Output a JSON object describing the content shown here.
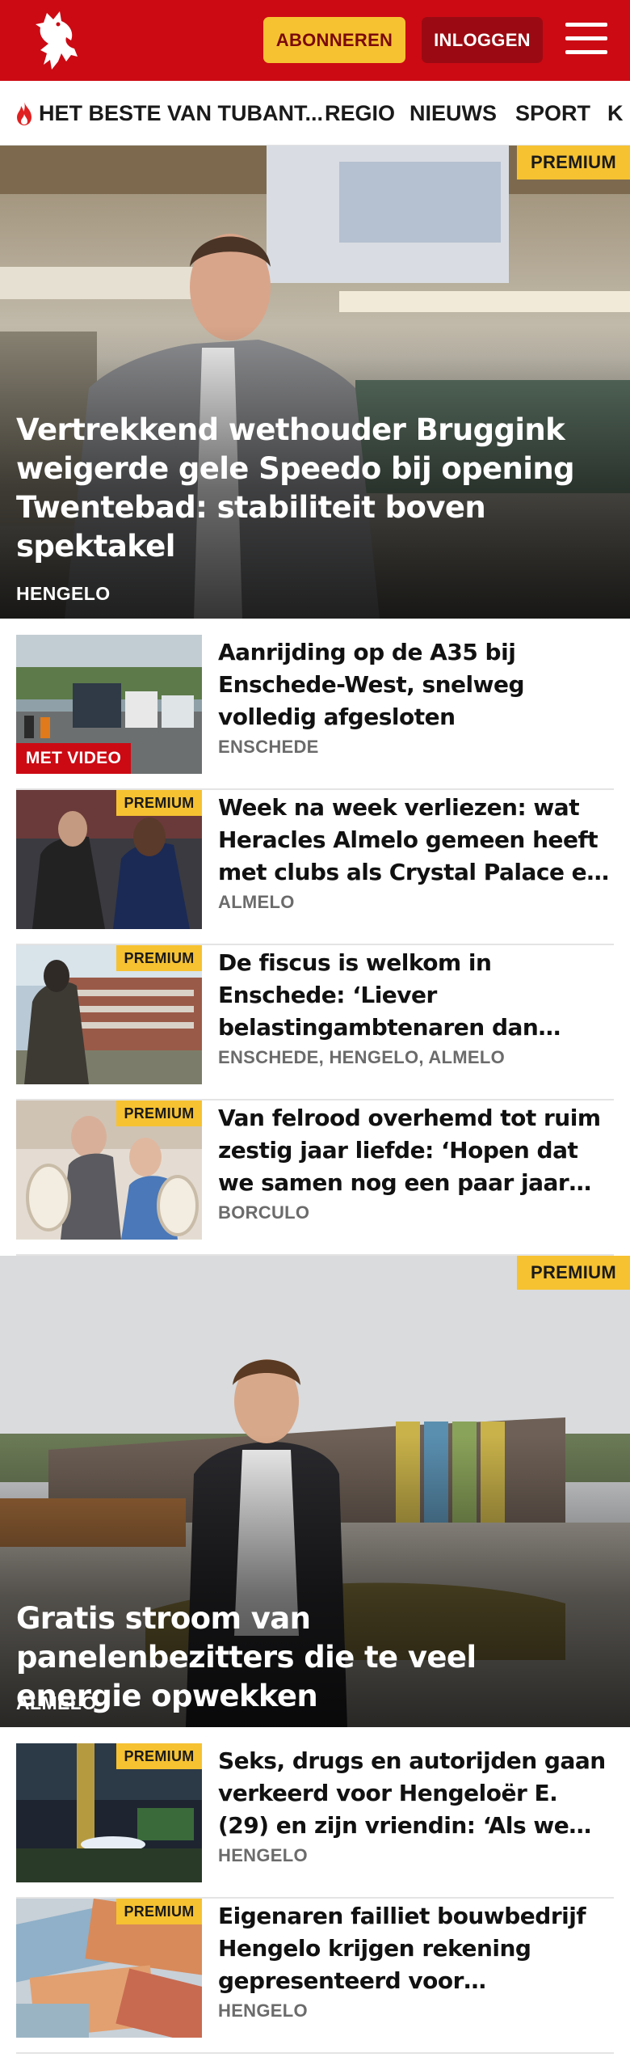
{
  "header": {
    "logo_icon": "tubantia-horse-logo-icon",
    "subscribe_label": "ABONNEREN",
    "login_label": "INLOGGEN",
    "menu_icon": "hamburger-menu-icon"
  },
  "nav": {
    "items": [
      {
        "label": "HET BESTE VAN TUBANT...",
        "icon": "flame-icon"
      },
      {
        "label": "REGIO"
      },
      {
        "label": "NIEUWS"
      },
      {
        "label": "SPORT"
      },
      {
        "label": "K"
      }
    ]
  },
  "hero1": {
    "badge": "PREMIUM",
    "title": "Vertrekkend wethouder Bruggink weigerde gele Speedo bij opening Twentebad: stabiliteit boven spektakel",
    "region": "HENGELO"
  },
  "articles1": [
    {
      "title": "Aanrijding op de A35 bij Enschede-West, snelweg volledig afgesloten",
      "place": "ENSCHEDE",
      "badge": "MET VIDEO"
    },
    {
      "title": "Week na week verliezen: wat Heracles Almelo gemeen heeft met clubs als Crystal Palace en Chelsea",
      "place": "ALMELO",
      "badge": "PREMIUM"
    },
    {
      "title": "De fiscus is welkom in Enschede: ‘Liever belastingambtenaren dan asielzoekers’",
      "place": "ENSCHEDE, HENGELO, ALMELO",
      "badge": "PREMIUM"
    },
    {
      "title": "Van felrood overhemd tot ruim zestig jaar liefde: ‘Hopen dat we samen nog een paar jaar door kunnen’",
      "place": "BORCULO",
      "badge": "PREMIUM"
    }
  ],
  "hero2": {
    "badge": "PREMIUM",
    "title": "Gratis stroom van panelenbezitters die te veel energie opwekken",
    "region": "ALMELO"
  },
  "articles2": [
    {
      "title": "Seks, drugs en autorijden gaan verkeerd voor Hengeloër E. (29) en zijn vriendin: ‘Als we ghb gebruikten...’",
      "place": "HENGELO",
      "badge": "PREMIUM"
    },
    {
      "title": "Eigenaren failliet bouwbedrijf Hengelo krijgen rekening gepresenteerd voor onbehoorlijk bestuur",
      "place": "HENGELO",
      "badge": "PREMIUM"
    }
  ],
  "colors": {
    "brand_red": "#cc0a14",
    "premium_yellow": "#f6c232",
    "login_dark_red": "#9b0a12"
  }
}
